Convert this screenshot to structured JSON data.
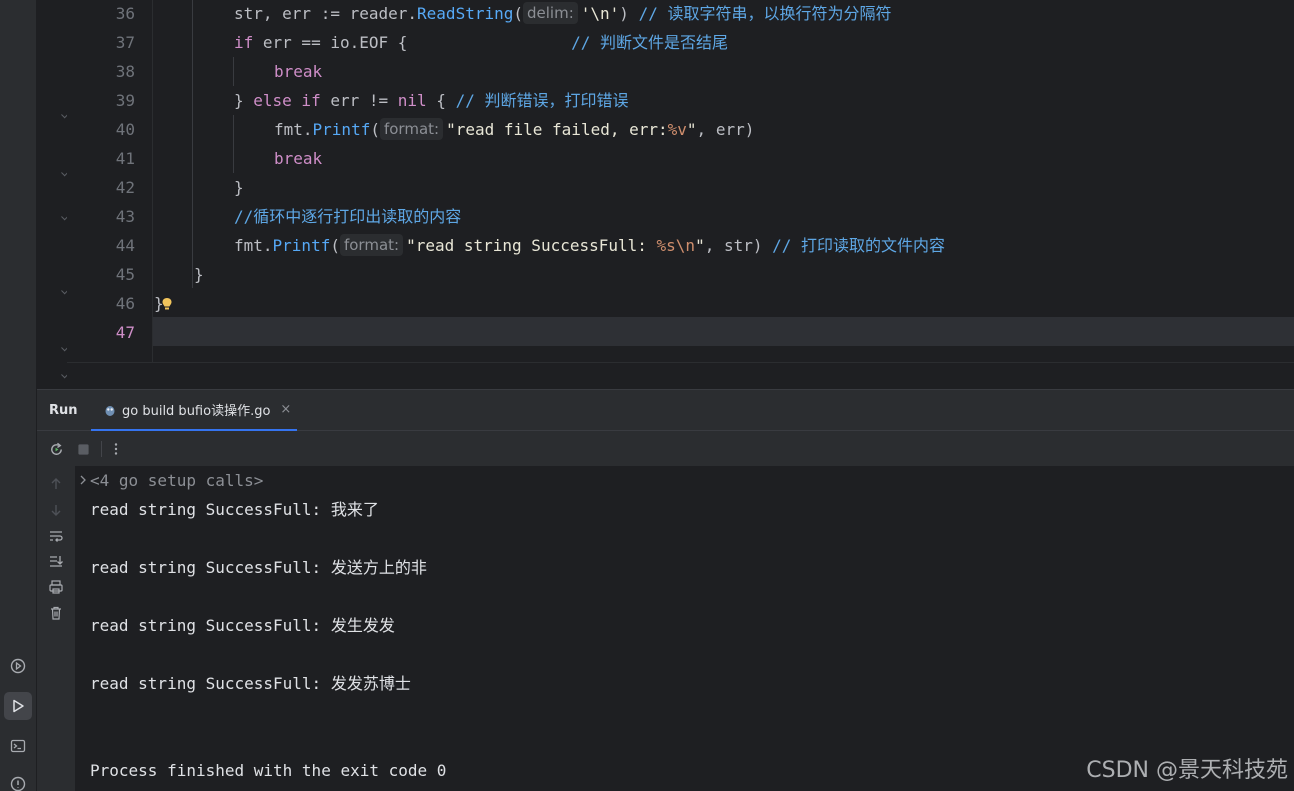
{
  "editor": {
    "line_numbers": [
      "36",
      "37",
      "38",
      "39",
      "40",
      "41",
      "42",
      "43",
      "44",
      "45",
      "46",
      "47"
    ],
    "current_line": "47",
    "lines": [
      {
        "num": "36",
        "parts": [
          {
            "t": "str, err := reader.",
            "c": "id"
          },
          {
            "t": "ReadString",
            "c": "fnc"
          },
          {
            "t": "(",
            "c": "id"
          },
          {
            "t": "delim:",
            "c": "hint"
          },
          {
            "t": "'\\n'",
            "c": "strw"
          },
          {
            "t": ") ",
            "c": "id"
          },
          {
            "t": "// 读取字符串，以换行符为分隔符",
            "c": "cm"
          }
        ]
      },
      {
        "num": "37",
        "parts": [
          {
            "t": "if",
            "c": "kw"
          },
          {
            "t": " err == io.EOF { ",
            "c": "id"
          },
          {
            "t": "                // 判断文件是否结尾",
            "c": "cm"
          }
        ]
      },
      {
        "num": "38",
        "parts": [
          {
            "t": "break",
            "c": "kw"
          }
        ]
      },
      {
        "num": "39",
        "parts": [
          {
            "t": "} ",
            "c": "id"
          },
          {
            "t": "else if",
            "c": "kw"
          },
          {
            "t": " err != ",
            "c": "id"
          },
          {
            "t": "nil",
            "c": "kw"
          },
          {
            "t": " { ",
            "c": "id"
          },
          {
            "t": "// 判断错误，打印错误",
            "c": "cm"
          }
        ]
      },
      {
        "num": "40",
        "parts": [
          {
            "t": "fmt.",
            "c": "id"
          },
          {
            "t": "Printf",
            "c": "fn"
          },
          {
            "t": "(",
            "c": "id"
          },
          {
            "t": "format:",
            "c": "hint"
          },
          {
            "t": "\"read file failed, err:",
            "c": "strw"
          },
          {
            "t": "%v",
            "c": "esc"
          },
          {
            "t": "\"",
            "c": "strw"
          },
          {
            "t": ", err)",
            "c": "id"
          }
        ]
      },
      {
        "num": "41",
        "parts": [
          {
            "t": "break",
            "c": "kw"
          }
        ]
      },
      {
        "num": "42",
        "parts": [
          {
            "t": "}",
            "c": "id"
          }
        ]
      },
      {
        "num": "43",
        "parts": [
          {
            "t": "//循环中逐行打印出读取的内容",
            "c": "cm"
          }
        ]
      },
      {
        "num": "44",
        "parts": [
          {
            "t": "fmt.",
            "c": "id"
          },
          {
            "t": "Printf",
            "c": "fn"
          },
          {
            "t": "(",
            "c": "id"
          },
          {
            "t": "format:",
            "c": "hint"
          },
          {
            "t": "\"read string SuccessFull: ",
            "c": "strw"
          },
          {
            "t": "%s",
            "c": "esc"
          },
          {
            "t": "\\n",
            "c": "esc"
          },
          {
            "t": "\"",
            "c": "strw"
          },
          {
            "t": ", str) ",
            "c": "id"
          },
          {
            "t": "// 打印读取的文件内容",
            "c": "cm"
          }
        ]
      },
      {
        "num": "45",
        "parts": [
          {
            "t": "}",
            "c": "id"
          }
        ]
      },
      {
        "num": "46",
        "parts": [
          {
            "t": "}",
            "c": "id"
          }
        ]
      },
      {
        "num": "47",
        "parts": []
      }
    ]
  },
  "run": {
    "title": "Run",
    "tab_label": "go build bufio读操作.go",
    "tab_close": "×"
  },
  "console": {
    "setup_calls": "<4 go setup calls>",
    "lines": [
      "read string SuccessFull: 我来了",
      "read string SuccessFull: 发送方上的非",
      "read string SuccessFull: 发生发发",
      "read string SuccessFull: 发发苏博士"
    ],
    "exit_message": "Process finished with the exit code 0"
  },
  "watermark": "CSDN @景天科技苑",
  "colors": {
    "keyword": "#cf8ec8",
    "function": "#56a8f5",
    "comment": "#5ea7e5",
    "accent": "#3574f0",
    "background": "#1e1f22",
    "panel": "#2b2d30"
  }
}
